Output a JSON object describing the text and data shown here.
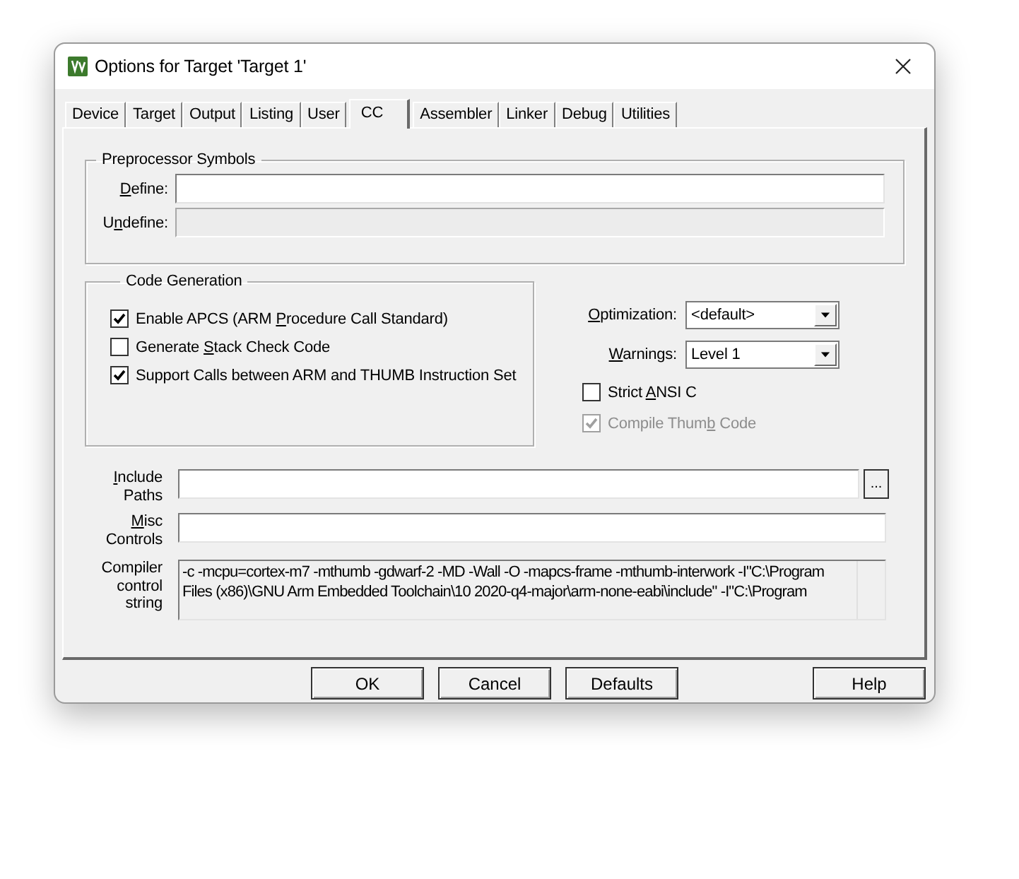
{
  "window": {
    "title": "Options for Target 'Target 1'"
  },
  "tabs": [
    {
      "label": "Device",
      "selected": false
    },
    {
      "label": "Target",
      "selected": false
    },
    {
      "label": "Output",
      "selected": false
    },
    {
      "label": "Listing",
      "selected": false
    },
    {
      "label": "User",
      "selected": false
    },
    {
      "label": "CC",
      "selected": true
    },
    {
      "label": "Assembler",
      "selected": false
    },
    {
      "label": "Linker",
      "selected": false
    },
    {
      "label": "Debug",
      "selected": false
    },
    {
      "label": "Utilities",
      "selected": false
    }
  ],
  "preprocessor": {
    "title": "Preprocessor Symbols",
    "fields": [
      {
        "access_key": "D",
        "label_end": "efine:",
        "disabled": false
      },
      {
        "label_start": "U",
        "access_key": "n",
        "label_end": "define:",
        "disabled": true
      }
    ]
  },
  "code_generation": {
    "title": "Code Generation",
    "options": [
      {
        "label_start": "Enable APCS (ARM ",
        "access_key": "P",
        "label_end": "rocedure Call Standard)",
        "checked": true,
        "disabled": false
      },
      {
        "label_start": "Generate ",
        "access_key": "S",
        "label_end": "tack Check Code",
        "checked": false,
        "disabled": false
      },
      {
        "label_start": "Support Calls between ARM and THUMB Instruction Set",
        "checked": true,
        "disabled": false
      }
    ]
  },
  "dropdowns": [
    {
      "access_key": "O",
      "label_end": "ptimization:",
      "value": "<default>"
    },
    {
      "access_key": "W",
      "label_end": "arnings:",
      "value": "Level 1"
    }
  ],
  "options": [
    {
      "label_start": "Strict ",
      "access_key": "A",
      "label_end": "NSI C",
      "checked": false,
      "disabled": false
    },
    {
      "label_start": "Compile Thum",
      "access_key": "b",
      "label_end": " Code",
      "checked": true,
      "disabled": true
    }
  ],
  "include_paths": {
    "access_key": "I",
    "label_end": "nclude Paths",
    "browse_button": "..."
  },
  "misc_controls": {
    "access_key": "M",
    "label_end": "isc Controls"
  },
  "compiler_control_string": {
    "label": "Compiler control string",
    "lines": [
      "-c -mcpu=cortex-m7 -mthumb -gdwarf-2 -MD -Wall -O -mapcs-frame -mthumb-interwork -I\"C:\\Program",
      "Files (x86)\\GNU Arm Embedded Toolchain\\10 2020-q4-major\\arm-none-eabi\\include\" -I\"C:\\Program"
    ]
  },
  "buttons": [
    "OK",
    "Cancel",
    "Defaults",
    "Help"
  ]
}
